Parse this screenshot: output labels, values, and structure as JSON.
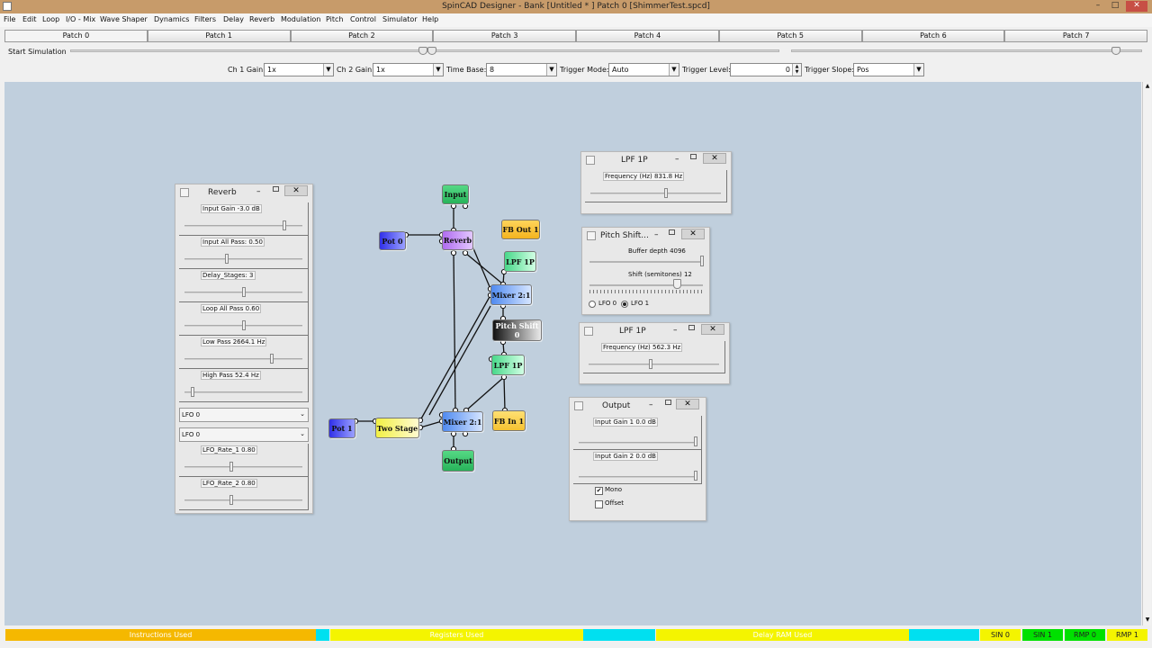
{
  "window": {
    "title": "SpinCAD Designer - Bank [Untitled * ] Patch 0 [ShimmerTest.spcd]",
    "min": "–",
    "max": "□",
    "close": "✕"
  },
  "menu": [
    "File",
    "Edit",
    "Loop",
    "I/O - Mix",
    "Wave Shaper",
    "Dynamics",
    "Filters",
    "Delay",
    "Reverb",
    "Modulation",
    "Pitch",
    "Control",
    "Simulator",
    "Help"
  ],
  "patches": [
    "Patch 0",
    "Patch 1",
    "Patch 2",
    "Patch 3",
    "Patch 4",
    "Patch 5",
    "Patch 6",
    "Patch 7"
  ],
  "simulation": {
    "start_label": "Start Simulation"
  },
  "scope": {
    "ch1_label": "Ch 1 Gain:",
    "ch1_value": "1x",
    "ch2_label": "Ch 2 Gain:",
    "ch2_value": "1x",
    "timebase_label": "Time Base:",
    "timebase_value": "8",
    "trigmode_label": "Trigger Mode:",
    "trigmode_value": "Auto",
    "triglevel_label": "Trigger Level:",
    "triglevel_value": "0",
    "trigslope_label": "Trigger Slope:",
    "trigslope_value": "Pos"
  },
  "reverb_panel": {
    "title": "Reverb",
    "params": [
      {
        "label": "Input Gain -3.0 dB",
        "level": 0.88
      },
      {
        "label": "Input All Pass: 0.50",
        "level": 0.36
      },
      {
        "label": "Delay_Stages:   3",
        "level": 0.5
      },
      {
        "label": "Loop All Pass 0.60",
        "level": 0.5
      },
      {
        "label": "Low Pass 2664.1 Hz",
        "level": 0.8
      },
      {
        "label": "High Pass 52.4 Hz",
        "level": 0.05
      }
    ],
    "lfo_select_1": "LFO 0",
    "lfo_select_2": "LFO 0",
    "lfo_params": [
      {
        "label": "LFO_Rate_1 0.80",
        "level": 0.39
      },
      {
        "label": "LFO_Rate_2 0.80",
        "level": 0.39
      }
    ]
  },
  "lpf_panel_1": {
    "title": "LPF 1P",
    "param": {
      "label": "Frequency (Hz) 831.8 Hz",
      "level": 0.6
    }
  },
  "pitch_panel": {
    "title": "Pitch Shift...",
    "buffer_label": "Buffer depth 4096",
    "shift_label": "Shift (semitones) 12",
    "lfo0_label": "LFO 0",
    "lfo1_label": "LFO 1"
  },
  "lpf_panel_2": {
    "title": "LPF 1P",
    "param": {
      "label": "Frequency (Hz) 562.3 Hz",
      "level": 0.5
    }
  },
  "output_panel": {
    "title": "Output",
    "params": [
      {
        "label": "Input Gain 1  0.0 dB",
        "level": 0.98
      },
      {
        "label": "Input Gain 2  0.0 dB",
        "level": 0.98
      }
    ],
    "mono_label": "Mono",
    "mono_checked": "✔",
    "offset_label": "Offset"
  },
  "blocks": {
    "input": "Input",
    "reverb": "Reverb",
    "pot0": "Pot 0",
    "fbout": "FB Out 1",
    "lpf_a": "LPF 1P",
    "mixer_a": "Mixer 2:1",
    "pitch": "Pitch Shift 0",
    "lpf_b": "LPF 1P",
    "fbin": "FB In 1",
    "pot1": "Pot 1",
    "twostage": "Two Stage",
    "mixer_b": "Mixer 2:1",
    "output": "Output"
  },
  "status": {
    "instructions": "Instructions Used",
    "registers": "Registers Used",
    "delay": "Delay RAM Used",
    "sin0": "SIN 0",
    "sin1": "SIN 1",
    "rmp0": "RMP 0",
    "rmp1": "RMP 1"
  },
  "colors": {
    "canvas": "#c0cfdd",
    "titlebar": "#c79b6a",
    "instructions": "#f5b800",
    "registers": "#f4f400",
    "delay": "#f4f400",
    "free": "#00e0f0",
    "sin_on": "#00e000",
    "rmp_on": "#f4f400"
  }
}
